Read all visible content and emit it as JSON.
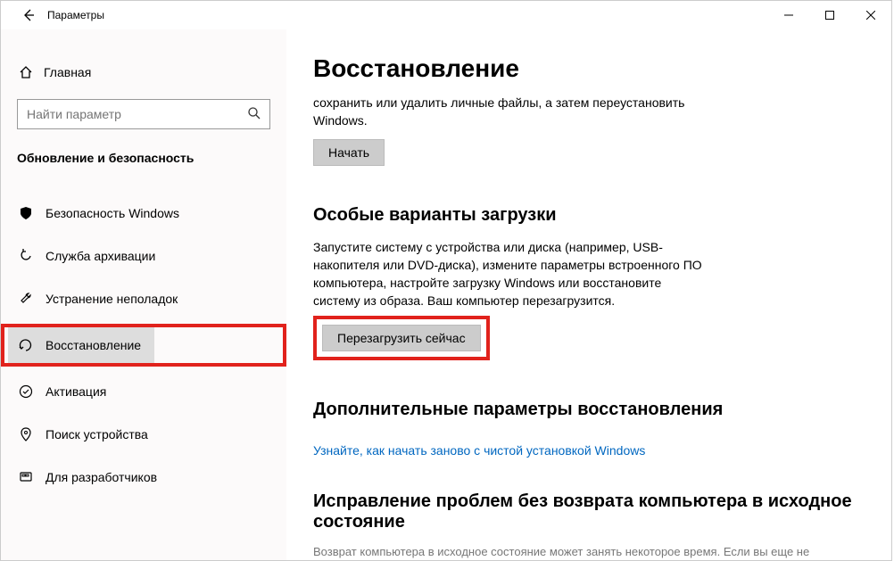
{
  "titlebar": {
    "title": "Параметры"
  },
  "sidebar": {
    "home_label": "Главная",
    "search_placeholder": "Найти параметр",
    "section_label": "Обновление и безопасность",
    "items": [
      {
        "label": "Безопасность Windows"
      },
      {
        "label": "Служба архивации"
      },
      {
        "label": "Устранение неполадок"
      },
      {
        "label": "Восстановление"
      },
      {
        "label": "Активация"
      },
      {
        "label": "Поиск устройства"
      },
      {
        "label": "Для разработчиков"
      }
    ]
  },
  "content": {
    "page_title": "Восстановление",
    "reset_desc": "сохранить или удалить личные файлы, а затем переустановить Windows.",
    "reset_btn": "Начать",
    "advanced_heading": "Особые варианты загрузки",
    "advanced_desc": "Запустите систему с устройства или диска (например, USB-накопителя или DVD-диска), измените параметры встроенного ПО компьютера, настройте загрузку Windows или восстановите систему из образа. Ваш компьютер перезагрузится.",
    "restart_btn": "Перезагрузить сейчас",
    "more_heading": "Дополнительные параметры восстановления",
    "more_link": "Узнайте, как начать заново с чистой установкой Windows",
    "trouble_heading": "Исправление проблем без возврата компьютера в исходное состояние",
    "trouble_text": "Возврат компьютера в исходное состояние может занять некоторое время. Если вы еще не"
  }
}
